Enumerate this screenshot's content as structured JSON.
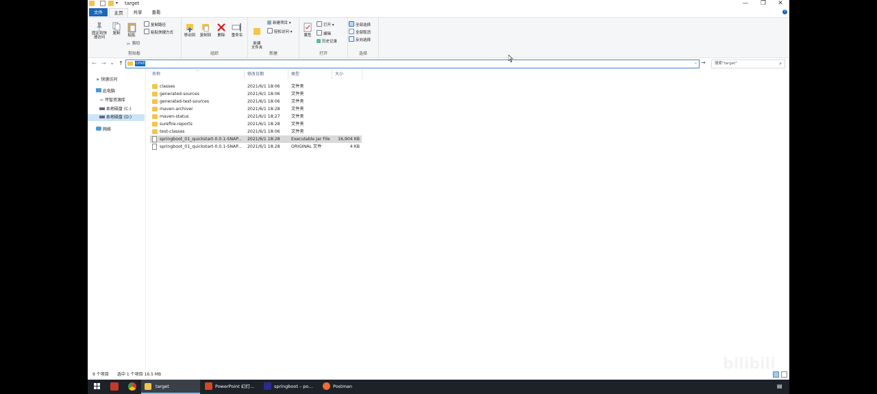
{
  "window": {
    "title": "target"
  },
  "window_controls": {
    "minimize": "—",
    "maximize": "❐",
    "close": "✕"
  },
  "tabs": [
    "文件",
    "主页",
    "共享",
    "查看"
  ],
  "help": "?",
  "ribbon": {
    "clipboard": {
      "pin": "固定到快速访问",
      "copy": "复制",
      "paste": "粘贴",
      "copy_path": "复制路径",
      "paste_shortcut": "粘贴快捷方式",
      "cut": "剪切",
      "label": "剪贴板"
    },
    "organize": {
      "move_to": "移动到",
      "copy_to": "复制到",
      "delete": "删除",
      "rename": "重命名",
      "label": "组织"
    },
    "new": {
      "new_folder": "新建\n文件夹",
      "new_item": "新建项目 ▾",
      "easy_access": "轻松访问 ▾",
      "label": "新建"
    },
    "open": {
      "properties": "属性",
      "open": "打开 ▾",
      "edit": "编辑",
      "history": "历史记录",
      "label": "打开"
    },
    "select": {
      "select_all": "全部选择",
      "select_none": "全部取消",
      "invert": "反向选择",
      "label": "选择"
    }
  },
  "address": {
    "value": "cmd"
  },
  "search": {
    "placeholder": "搜索\"target\""
  },
  "nav": [
    {
      "label": "快速访问",
      "icon": "star-icon"
    },
    {
      "label": "此电脑",
      "icon": "computer-icon"
    },
    {
      "label": "传智资源库",
      "icon": "network-drive-icon"
    },
    {
      "label": "本地磁盘 (C:)",
      "icon": "drive-icon"
    },
    {
      "label": "本地磁盘 (D:)",
      "icon": "drive-icon"
    },
    {
      "label": "网络",
      "icon": "network-icon"
    }
  ],
  "columns": [
    "名称",
    "修改日期",
    "类型",
    "大小"
  ],
  "files": [
    {
      "name": "classes",
      "date": "2021/6/1 18:06",
      "type": "文件夹",
      "size": "",
      "kind": "folder"
    },
    {
      "name": "generated-sources",
      "date": "2021/6/1 18:06",
      "type": "文件夹",
      "size": "",
      "kind": "folder"
    },
    {
      "name": "generated-test-sources",
      "date": "2021/6/1 18:06",
      "type": "文件夹",
      "size": "",
      "kind": "folder"
    },
    {
      "name": "maven-archiver",
      "date": "2021/6/1 18:28",
      "type": "文件夹",
      "size": "",
      "kind": "folder"
    },
    {
      "name": "maven-status",
      "date": "2021/6/1 18:27",
      "type": "文件夹",
      "size": "",
      "kind": "folder"
    },
    {
      "name": "surefire-reports",
      "date": "2021/6/1 18:28",
      "type": "文件夹",
      "size": "",
      "kind": "folder"
    },
    {
      "name": "test-classes",
      "date": "2021/6/1 18:06",
      "type": "文件夹",
      "size": "",
      "kind": "folder"
    },
    {
      "name": "springboot_01_quickstart-0.0.1-SNAP...",
      "date": "2021/6/1 18:28",
      "type": "Executable Jar File",
      "size": "16,904 KB",
      "kind": "jar",
      "selected": true
    },
    {
      "name": "springboot_01_quickstart-0.0.1-SNAP...",
      "date": "2021/6/1 18:28",
      "type": "ORIGINAL 文件",
      "size": "4 KB",
      "kind": "file"
    }
  ],
  "status": {
    "count": "9 个项目",
    "selected": "选中 1 个项目  16.5 MB"
  },
  "taskbar": [
    {
      "label": "target",
      "icon": "folder-icon"
    },
    {
      "label": "PowerPoint 幻灯...",
      "icon": "powerpoint-icon"
    },
    {
      "label": "springboot – po...",
      "icon": "intellij-icon"
    },
    {
      "label": "Postman",
      "icon": "postman-icon"
    }
  ],
  "colors": {
    "accent": "#1a66b8",
    "folder": "#f4c54a",
    "selected": "#d9d9d9",
    "taskbar": "#1d2128"
  }
}
